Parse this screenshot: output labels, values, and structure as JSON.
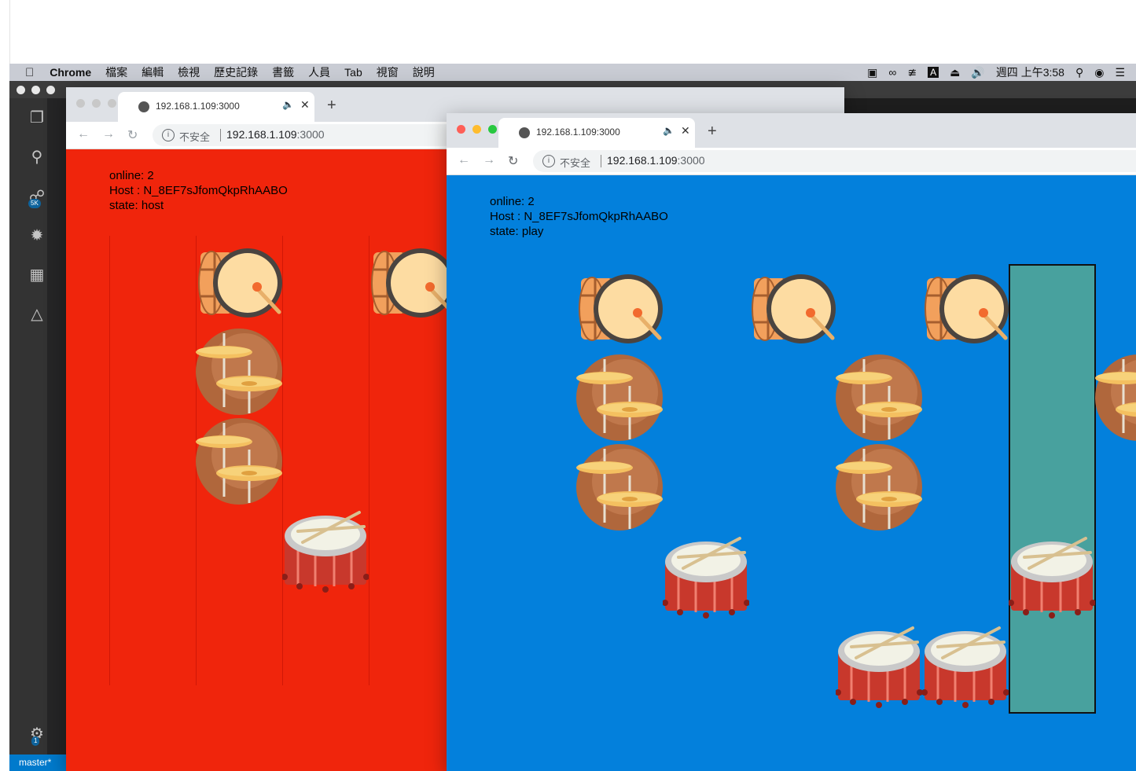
{
  "menubar": {
    "app_name": "Chrome",
    "items": [
      "檔案",
      "編輯",
      "檢視",
      "歷史記錄",
      "書籤",
      "人員",
      "Tab",
      "視窗",
      "說明"
    ],
    "clock": "週四 上午3:58",
    "input_source": "A"
  },
  "vscode": {
    "branch": "master*",
    "scm_badge": "5K",
    "settings_badge": "1"
  },
  "window_left": {
    "tab_title": "192.168.1.109:3000",
    "insecure_label": "不安全",
    "url_host": "192.168.1.109",
    "url_port": ":3000",
    "background": "#f0250c",
    "status": {
      "online": "online: 2",
      "host": "Host  : N_8EF7sJfomQkpRhAABO",
      "state": "state: host"
    }
  },
  "window_right": {
    "tab_title": "192.168.1.109:3000",
    "insecure_label": "不安全",
    "url_host": "192.168.1.109",
    "url_port": ":3000",
    "background": "#0380dc",
    "status": {
      "online": "online: 2",
      "host": "Host  : N_8EF7sJfomQkpRhAABO",
      "state": "state: play"
    }
  },
  "icons": {
    "bass_drum": "bass-drum-icon",
    "cymbals": "cymbal-icon",
    "snare_drum": "snare-drum-icon"
  }
}
